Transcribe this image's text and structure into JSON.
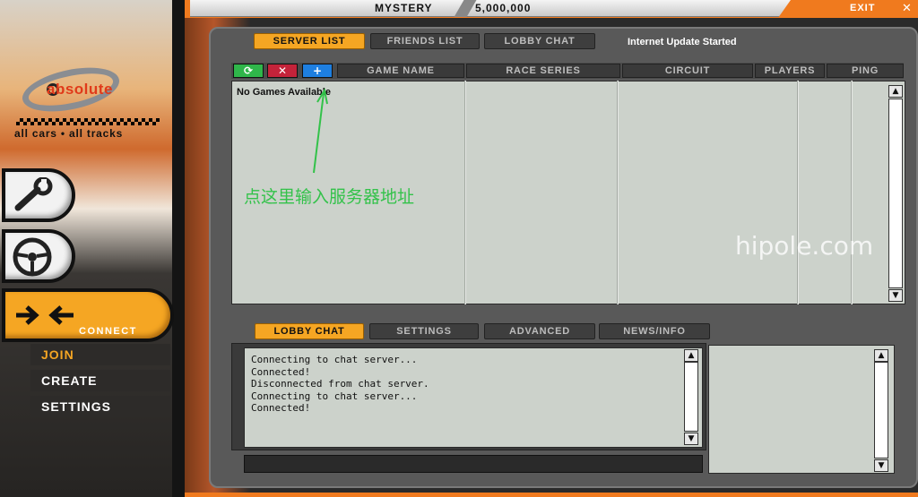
{
  "topbar": {
    "mode_title": "MYSTERY",
    "credits": "5,000,000",
    "exit_label": "EXIT"
  },
  "sidebar": {
    "logo_text": "absolute",
    "tagline": "all cars • all tracks",
    "connect_label": "CONNECT",
    "menu": {
      "join": "JOIN",
      "create": "CREATE",
      "settings": "SETTINGS"
    }
  },
  "top_tabs": {
    "server_list": "SERVER LIST",
    "friends_list": "FRIENDS LIST",
    "lobby_chat": "LOBBY CHAT"
  },
  "status": "Internet Update Started",
  "server_table": {
    "columns": {
      "game_name": "GAME NAME",
      "race_series": "RACE SERIES",
      "circuit": "CIRCUIT",
      "players": "PLAYERS",
      "ping": "PING"
    },
    "empty_message": "No Games Available"
  },
  "toolbar": {
    "refresh": "⟳",
    "remove": "✕",
    "add": "+"
  },
  "annotation": "点这里输入服务器地址",
  "watermark": "hipole.com",
  "bottom_tabs": {
    "lobby_chat": "LOBBY CHAT",
    "settings": "SETTINGS",
    "advanced": "ADVANCED",
    "news_info": "NEWS/INFO"
  },
  "chat_log": [
    "Connecting to chat server...",
    "Connected!",
    "Disconnected from chat server.",
    "Connecting to chat server...",
    "Connected!"
  ],
  "colors": {
    "accent": "#f5a623",
    "brand_orange": "#f07a1e",
    "panel": "#595959",
    "list_bg": "#ccd2cb",
    "annotation_green": "#33c24a"
  }
}
